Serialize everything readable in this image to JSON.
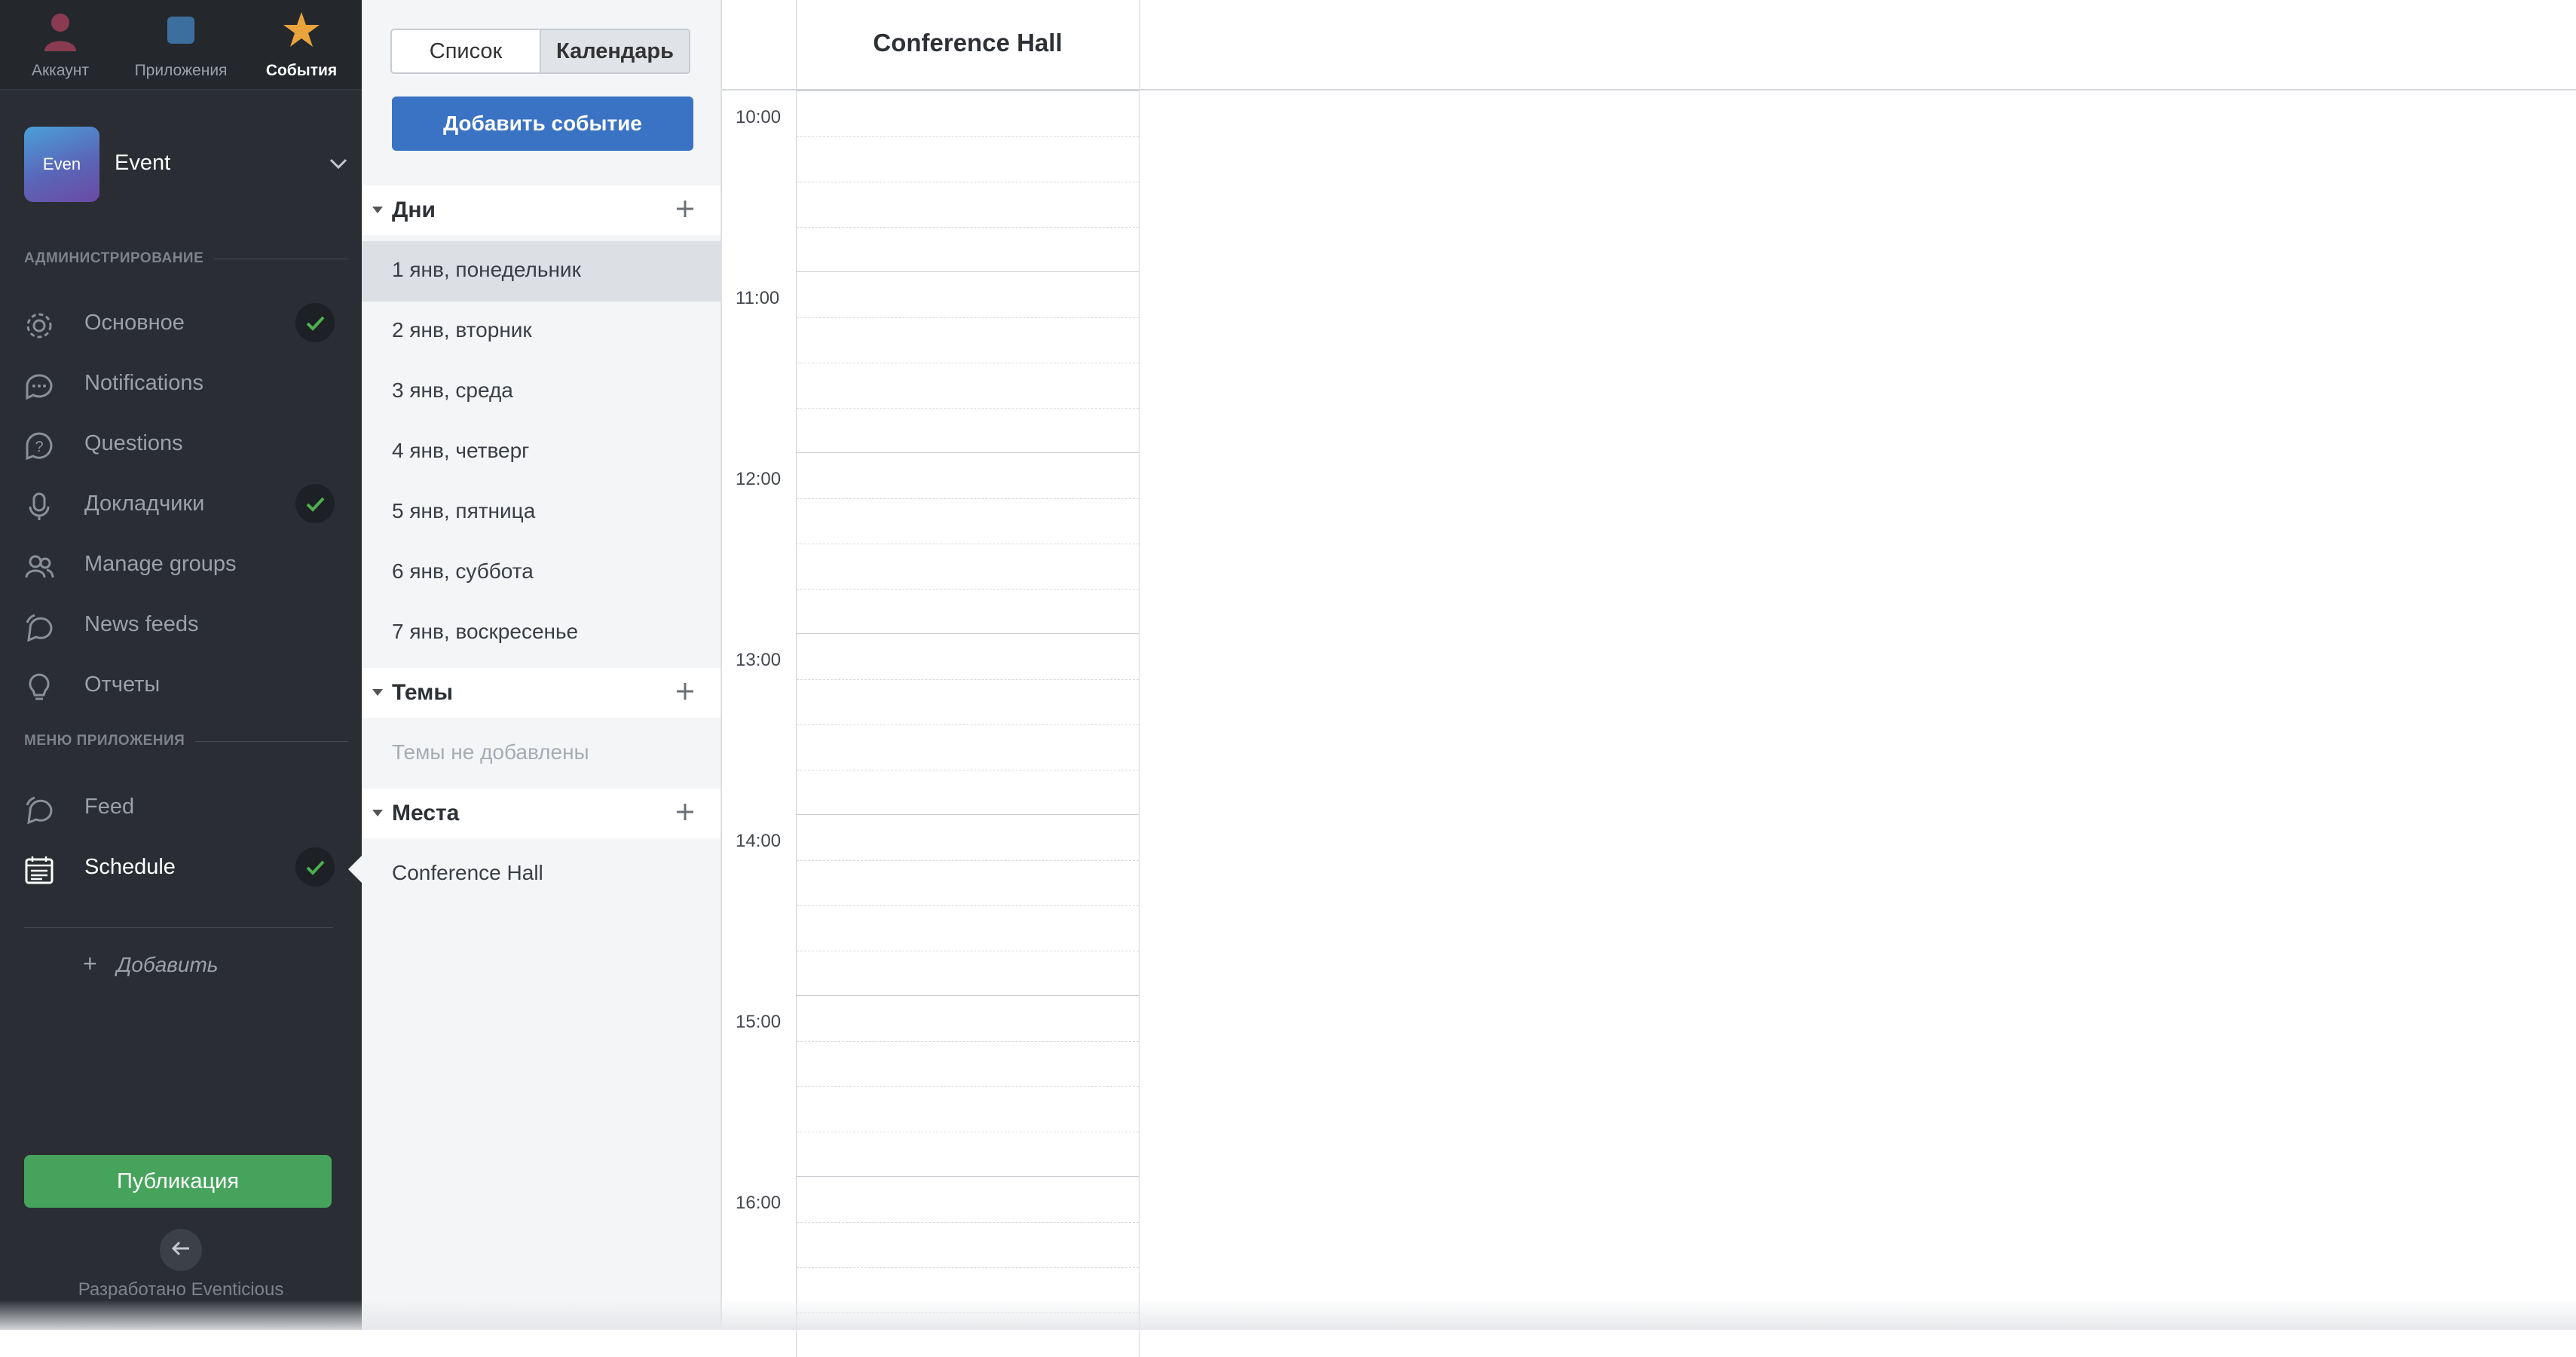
{
  "topnav": {
    "tabs": [
      {
        "label": "Аккаунт",
        "icon": "user-icon",
        "active": false
      },
      {
        "label": "Приложения",
        "icon": "apps-icon",
        "active": false
      },
      {
        "label": "События",
        "icon": "star-icon",
        "active": true
      }
    ]
  },
  "event": {
    "logo_text": "Even",
    "name": "Event"
  },
  "sidebar": {
    "admin_header": "АДМИНИСТРИРОВАНИЕ",
    "admin_items": [
      {
        "label": "Основное",
        "icon": "gear-icon",
        "checked": true
      },
      {
        "label": "Notifications",
        "icon": "chat-icon",
        "checked": false
      },
      {
        "label": "Questions",
        "icon": "question-icon",
        "checked": false
      },
      {
        "label": "Докладчики",
        "icon": "microphone-icon",
        "checked": true
      },
      {
        "label": "Manage groups",
        "icon": "users-icon",
        "checked": false
      },
      {
        "label": "News feeds",
        "icon": "feed-icon",
        "checked": false
      },
      {
        "label": "Отчеты",
        "icon": "lightbulb-icon",
        "checked": false
      }
    ],
    "app_header": "МЕНЮ ПРИЛОЖЕНИЯ",
    "app_items": [
      {
        "label": "Feed",
        "icon": "feed-icon",
        "checked": false
      },
      {
        "label": "Schedule",
        "icon": "calendar-icon",
        "checked": true,
        "active": true
      }
    ],
    "add_label": "Добавить",
    "publish_label": "Публикация",
    "credit": "Разработано Eventicious"
  },
  "panel": {
    "view_toggle": {
      "list": "Список",
      "calendar": "Календарь",
      "selected": "calendar"
    },
    "add_event_label": "Добавить событие",
    "days_header": "Дни",
    "days": [
      "1 янв, понедельник",
      "2 янв, вторник",
      "3 янв, среда",
      "4 янв, четверг",
      "5 янв, пятница",
      "6 янв, суббота",
      "7 янв, воскресенье"
    ],
    "selected_day": 0,
    "topics_header": "Темы",
    "topics_empty": "Темы не добавлены",
    "places_header": "Места",
    "places": [
      "Conference Hall"
    ]
  },
  "calendar": {
    "room": "Conference Hall",
    "hours": [
      "10:00",
      "11:00",
      "12:00",
      "13:00",
      "14:00",
      "15:00",
      "16:00"
    ]
  },
  "colors": {
    "sidebar_bg": "#2a2e34",
    "accent_blue": "#3a73c4",
    "publish_green": "#46a35b",
    "check_green": "#4caf50"
  }
}
